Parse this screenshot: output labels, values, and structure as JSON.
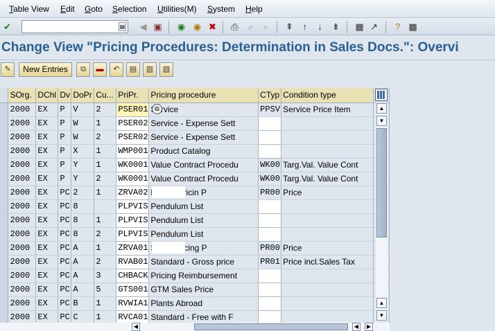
{
  "menu": [
    {
      "label": "Table View"
    },
    {
      "label": "Edit"
    },
    {
      "label": "Goto"
    },
    {
      "label": "Selection"
    },
    {
      "label": "Utilities(M)"
    },
    {
      "label": "System"
    },
    {
      "label": "Help"
    }
  ],
  "toolbar": {
    "command_field_value": ""
  },
  "title": "Change View \"Pricing Procedures: Determination in Sales Docs.\": Overvi",
  "app_toolbar": {
    "new_entries_label": "New Entries"
  },
  "table": {
    "headers": [
      "SOrg.",
      "DChl",
      "Dv",
      "DoPr",
      "Cu...",
      "PriPr.",
      "Pricing procedure",
      "CTyp",
      "Condition type"
    ],
    "rows": [
      [
        "2000",
        "EX",
        "P",
        "V",
        "2",
        "PSER01",
        "Service",
        "PPSV",
        "Service Price Item"
      ],
      [
        "2000",
        "EX",
        "P",
        "W",
        "1",
        "PSER02",
        "Service - Expense Sett",
        "",
        ""
      ],
      [
        "2000",
        "EX",
        "P",
        "W",
        "2",
        "PSER02",
        "Service - Expense Sett",
        "",
        ""
      ],
      [
        "2000",
        "EX",
        "P",
        "X",
        "1",
        "WMP001",
        "Product Catalog",
        "",
        ""
      ],
      [
        "2000",
        "EX",
        "P",
        "Y",
        "1",
        "WK0001",
        "Value Contract Procedu",
        "WK00",
        "Targ.Val. Value Cont"
      ],
      [
        "2000",
        "EX",
        "P",
        "Y",
        "2",
        "WK0001",
        "Value Contract Procedu",
        "WK00",
        "Targ.Val. Value Cont"
      ],
      [
        "2000",
        "EX",
        "PC",
        "2",
        "1",
        "ZRVA02",
        "Return Pricin P",
        "PR00",
        "Price"
      ],
      [
        "2000",
        "EX",
        "PC",
        "8",
        "",
        "PLPVIS",
        "Pendulum List",
        "",
        ""
      ],
      [
        "2000",
        "EX",
        "PC",
        "8",
        "1",
        "PLPVIS",
        "Pendulum List",
        "",
        ""
      ],
      [
        "2000",
        "EX",
        "PC",
        "8",
        "2",
        "PLPVIS",
        "Pendulum List",
        "",
        ""
      ],
      [
        "2000",
        "EX",
        "PC",
        "A",
        "1",
        "ZRVA01",
        "Sales Pricing P",
        "PR00",
        "Price"
      ],
      [
        "2000",
        "EX",
        "PC",
        "A",
        "2",
        "RVAB01",
        "Standard - Gross price",
        "PR01",
        "Price incl.Sales Tax"
      ],
      [
        "2000",
        "EX",
        "PC",
        "A",
        "3",
        "CHBACK",
        "Pricing Reimbursement",
        "",
        ""
      ],
      [
        "2000",
        "EX",
        "PC",
        "A",
        "5",
        "GTS001",
        "GTM Sales Price",
        "",
        ""
      ],
      [
        "2000",
        "EX",
        "PC",
        "B",
        "1",
        "RVWIA1",
        "Plants Abroad",
        "",
        ""
      ],
      [
        "2000",
        "EX",
        "PC",
        "C",
        "1",
        "RVCA01",
        "Standard - Free with F",
        "",
        ""
      ]
    ]
  }
}
